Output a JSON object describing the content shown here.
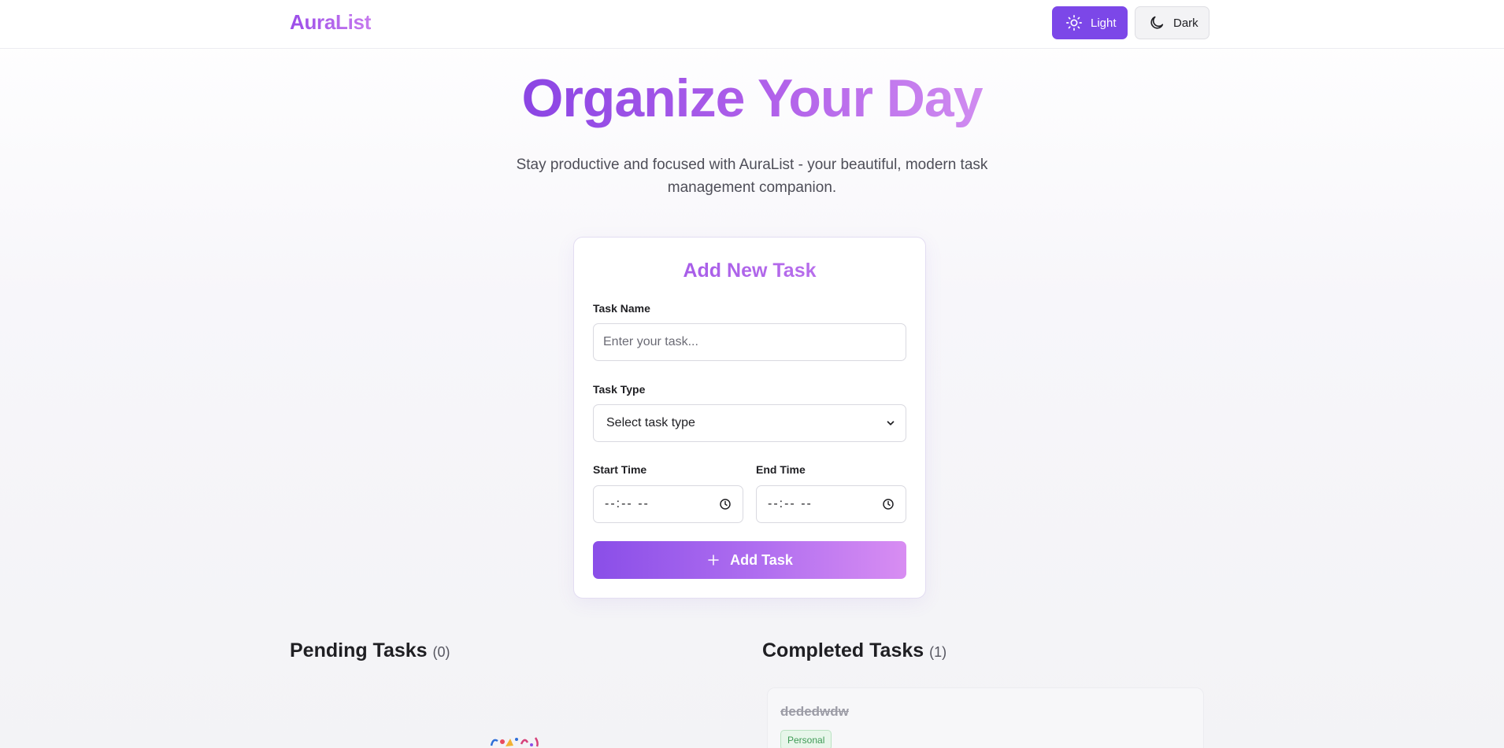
{
  "header": {
    "brand": "AuraList",
    "theme_light_label": "Light",
    "theme_dark_label": "Dark"
  },
  "hero": {
    "title": "Organize Your Day",
    "subtitle": "Stay productive and focused with AuraList - your beautiful, modern task management companion."
  },
  "form": {
    "title": "Add New Task",
    "task_name_label": "Task Name",
    "task_name_placeholder": "Enter your task...",
    "task_type_label": "Task Type",
    "task_type_selected": "Select task type",
    "start_time_label": "Start Time",
    "start_time_value": "--:-- --",
    "end_time_label": "End Time",
    "end_time_value": "--:-- --",
    "submit_label": "Add Task"
  },
  "pending": {
    "title": "Pending Tasks",
    "count": "(0)"
  },
  "completed": {
    "title": "Completed Tasks",
    "count": "(1)",
    "tasks": [
      {
        "name": "dededwdw",
        "type": "Personal"
      }
    ]
  },
  "colors": {
    "accent": "#7c47e8",
    "gradient_start": "#8a4ee8",
    "gradient_end": "#d88df2",
    "badge_personal": "#3e9a55"
  }
}
